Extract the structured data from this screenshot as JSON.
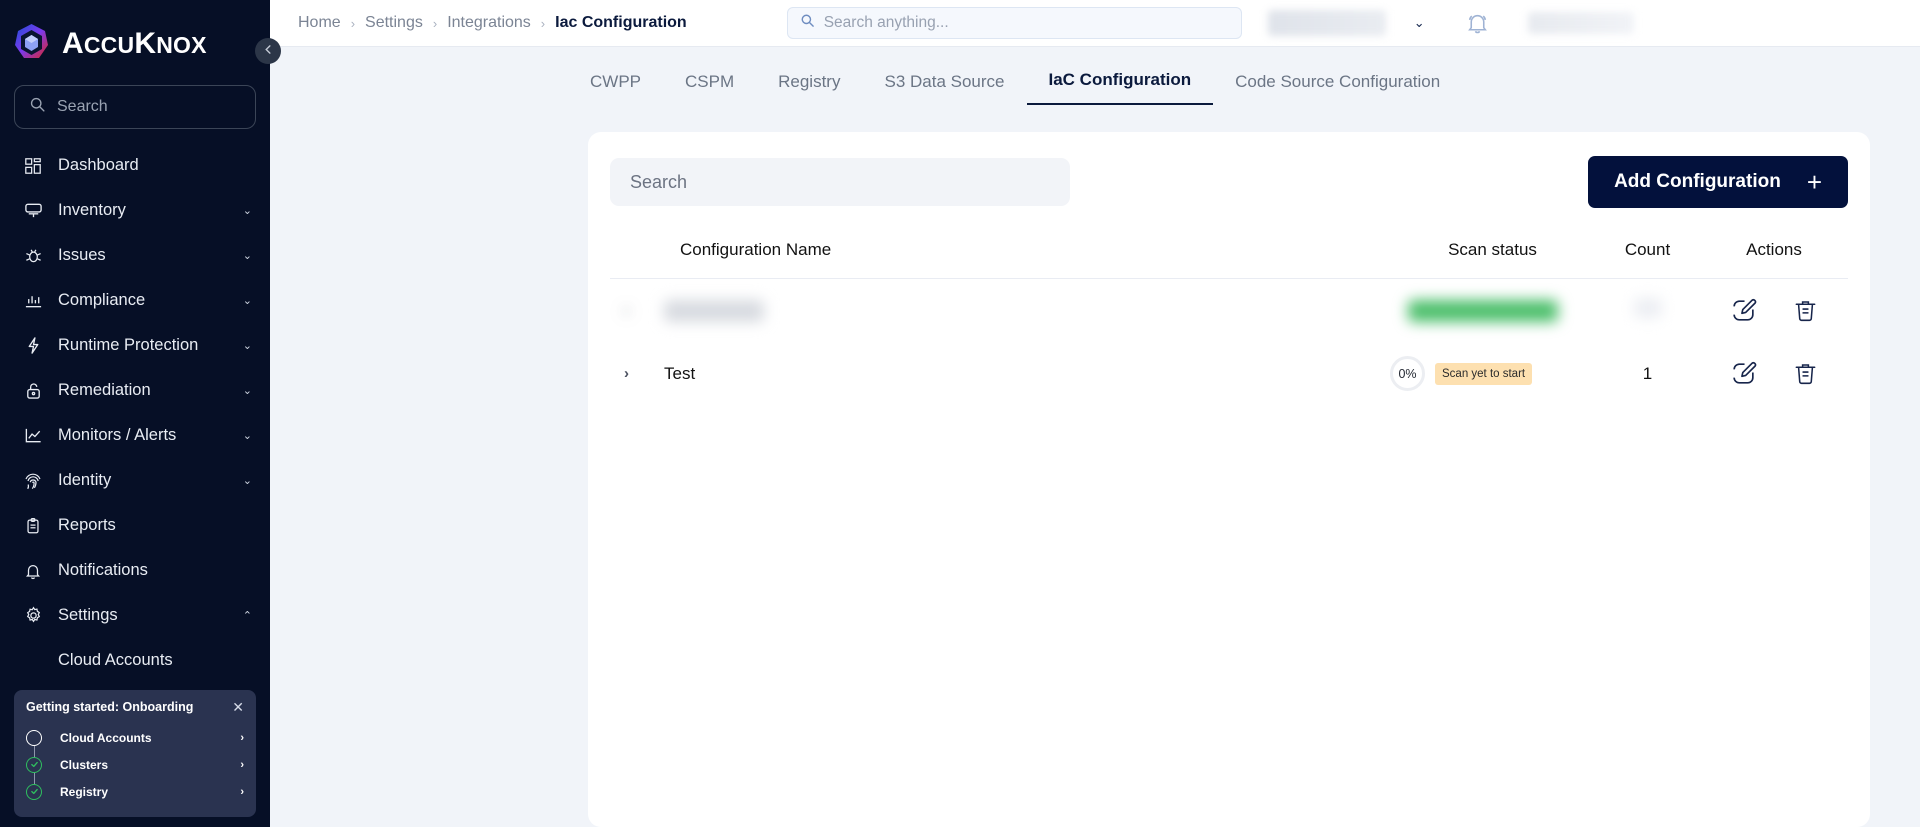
{
  "brand": {
    "name_strong": "A",
    "name_rest": "CCU",
    "name_k": "K",
    "name_nox": "NOX",
    "full": "AccuKnox"
  },
  "sidebar": {
    "search_placeholder": "Search",
    "collapse_icon": "chevron-left-icon",
    "items": [
      {
        "label": "Dashboard",
        "icon": "grid-icon",
        "caret": ""
      },
      {
        "label": "Inventory",
        "icon": "monitor-icon",
        "caret": "⌄"
      },
      {
        "label": "Issues",
        "icon": "bug-icon",
        "caret": "⌄"
      },
      {
        "label": "Compliance",
        "icon": "bar-chart-icon",
        "caret": "⌄"
      },
      {
        "label": "Runtime Protection",
        "icon": "bolt-icon",
        "caret": "⌄"
      },
      {
        "label": "Remediation",
        "icon": "unlock-icon",
        "caret": "⌄"
      },
      {
        "label": "Monitors / Alerts",
        "icon": "line-chart-icon",
        "caret": "⌄"
      },
      {
        "label": "Identity",
        "icon": "fingerprint-icon",
        "caret": "⌄"
      },
      {
        "label": "Reports",
        "icon": "clipboard-icon",
        "caret": ""
      },
      {
        "label": "Notifications",
        "icon": "bell-icon",
        "caret": ""
      },
      {
        "label": "Settings",
        "icon": "gear-icon",
        "caret": "⌃"
      }
    ],
    "sub_items": [
      {
        "label": "Cloud Accounts"
      }
    ]
  },
  "onboarding": {
    "title": "Getting started: Onboarding",
    "close_label": "✕",
    "steps": [
      {
        "label": "Cloud Accounts",
        "state": "todo",
        "caret": "›"
      },
      {
        "label": "Clusters",
        "state": "done",
        "caret": "›"
      },
      {
        "label": "Registry",
        "state": "done",
        "caret": "›"
      }
    ]
  },
  "topbar": {
    "breadcrumbs": [
      {
        "label": "Home",
        "active": false
      },
      {
        "label": "Settings",
        "active": false
      },
      {
        "label": "Integrations",
        "active": false
      },
      {
        "label": "Iac Configuration",
        "active": true
      }
    ],
    "separator": "›",
    "search_placeholder": "Search anything...",
    "tenant_caret": "⌄",
    "bell_icon": "bell-icon"
  },
  "tabs": [
    {
      "label": "CWPP",
      "active": false
    },
    {
      "label": "CSPM",
      "active": false
    },
    {
      "label": "Registry",
      "active": false
    },
    {
      "label": "S3 Data Source",
      "active": false
    },
    {
      "label": "IaC Configuration",
      "active": true
    },
    {
      "label": "Code Source Configuration",
      "active": false
    }
  ],
  "toolbar": {
    "search_placeholder": "Search",
    "add_label": "Add Configuration",
    "add_plus": "+"
  },
  "table": {
    "headers": {
      "name": "Configuration Name",
      "status": "Scan status",
      "count": "Count",
      "actions": "Actions"
    },
    "rows": [
      {
        "redacted": true,
        "name": "",
        "percent": "",
        "status": "",
        "count": "",
        "caret": "›"
      },
      {
        "redacted": false,
        "name": "Test",
        "percent": "0%",
        "status": "Scan yet to start",
        "count": "1",
        "caret": "›"
      }
    ],
    "edit_icon": "edit-pencil-icon",
    "delete_icon": "trash-icon"
  },
  "colors": {
    "sidebar_bg": "#060f26",
    "page_bg": "#f1f4f9",
    "accent_dark": "#03113c",
    "badge_warn_bg": "#fde0b0",
    "status_green": "#4cbf6b"
  }
}
